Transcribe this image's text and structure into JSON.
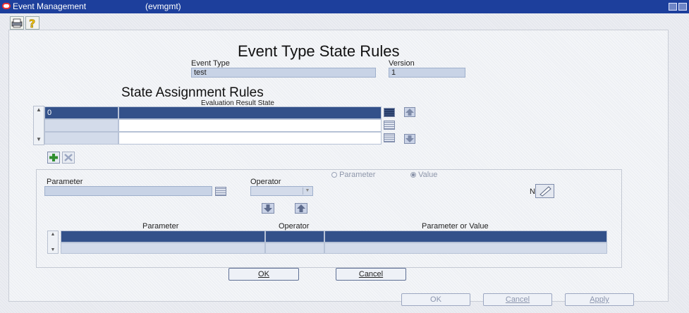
{
  "window": {
    "title": "Event Management",
    "subtitle": "(evmgmt)"
  },
  "form": {
    "heading": "Event Type State Rules",
    "event_type_label": "Event Type",
    "event_type_value": "test",
    "version_label": "Version",
    "version_value": "1"
  },
  "state_rules": {
    "heading": "State Assignment Rules",
    "column_header": "Evaluation Result State",
    "rows": [
      {
        "value": "0",
        "state": ""
      },
      {
        "value": "",
        "state": ""
      },
      {
        "value": "",
        "state": ""
      }
    ]
  },
  "condition": {
    "parameter_label": "Parameter",
    "operator_label": "Operator",
    "radio_parameter": "Parameter",
    "radio_value": "Value",
    "n_label": "N",
    "table_headers": [
      "Parameter",
      "Operator",
      "Parameter or Value"
    ]
  },
  "dialog_buttons": {
    "ok": "OK",
    "cancel": "Cancel"
  },
  "footer_buttons": {
    "ok": "OK",
    "cancel": "Cancel",
    "apply": "Apply"
  },
  "colors": {
    "titlebar": "#1d3f9c",
    "selected_row": "#33518a",
    "field": "#c8d3e6"
  },
  "icons": {
    "toolbar": [
      "printer-icon",
      "help-icon"
    ],
    "row_actions": [
      "add-icon",
      "delete-icon"
    ]
  }
}
